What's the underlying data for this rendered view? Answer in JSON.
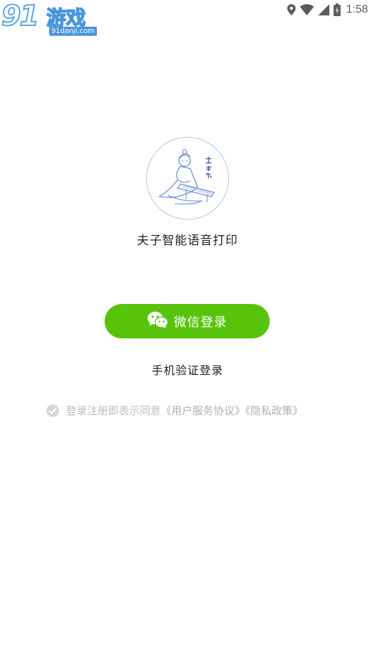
{
  "status_bar": {
    "time": "1:58",
    "icons": [
      "location-icon",
      "wifi-icon",
      "signal-icon",
      "battery-icon"
    ]
  },
  "watermark": {
    "number": "91",
    "name": "游戏",
    "url": "91danji.com"
  },
  "app": {
    "name": "夫子智能语音打印",
    "logo_icon": "fuzi-logo-icon"
  },
  "login": {
    "wechat_label": "微信登录",
    "phone_label": "手机验证登录"
  },
  "agreement": {
    "prefix": "登录注册即表示同意",
    "user_agreement": "《用户服务协议》",
    "privacy_policy": "《隐私政策》"
  },
  "colors": {
    "wechat_green": "#57c30b",
    "logo_border": "#b3c6ec",
    "muted_text": "#bdbdbd"
  }
}
